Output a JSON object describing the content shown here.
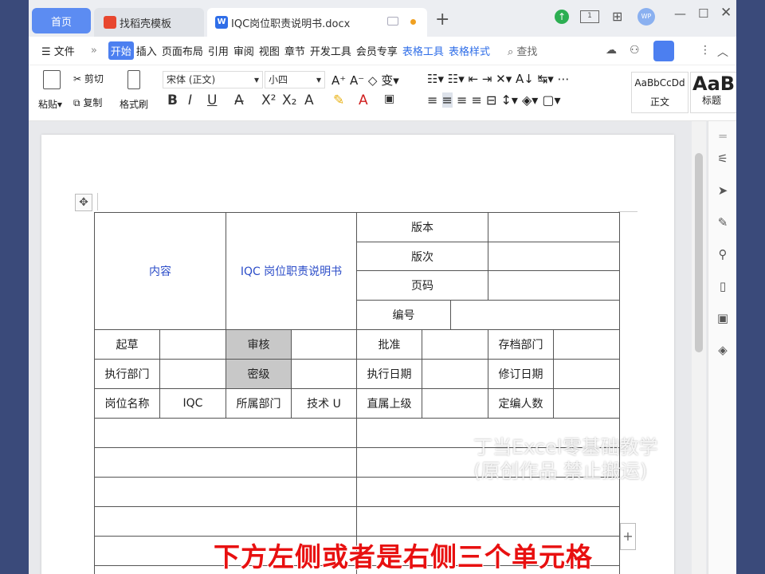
{
  "tabs": {
    "home": "首页",
    "template": "找稻壳模板",
    "document": "IQC岗位职责说明书.docx",
    "add": "+"
  },
  "window": {
    "min": "—",
    "max": "☐",
    "close": "✕",
    "layout_badge": "1"
  },
  "menu": {
    "file": "文件",
    "more": "»",
    "items": [
      "开始",
      "插入",
      "页面布局",
      "引用",
      "审阅",
      "视图",
      "章节",
      "开发工具",
      "会员专享"
    ],
    "table_tools": "表格工具",
    "table_style": "表格样式",
    "search": "查找"
  },
  "ribbon": {
    "paste": "粘贴",
    "cut": "剪切",
    "copy": "复制",
    "format_painter": "格式刷",
    "font_name": "宋体 (正文)",
    "font_size": "小四",
    "style_normal_preview": "AaBbCcDd",
    "style_normal": "正文",
    "style_heading_preview": "AaB",
    "style_heading": "标题"
  },
  "table": {
    "content": "内容",
    "title": "IQC 岗位职责说明书",
    "version": "版本",
    "edition": "版次",
    "page_no": "页码",
    "number": "编号",
    "draft": "起草",
    "review": "审核",
    "approve": "批准",
    "archive_dept": "存档部门",
    "exec_dept": "执行部门",
    "secrecy": "密级",
    "exec_date": "执行日期",
    "revise_date": "修订日期",
    "post_name": "岗位名称",
    "post_value": "IQC",
    "dept": "所属部门",
    "dept_value": "技术 U",
    "superior": "直属上级",
    "headcount": "定编人数"
  },
  "overlay": {
    "watermark_line1": "丁当Excel零基础教学",
    "watermark_line2": "(原创作品 禁止搬运)",
    "subtitle": "下方左侧或者是右侧三个单元格"
  }
}
